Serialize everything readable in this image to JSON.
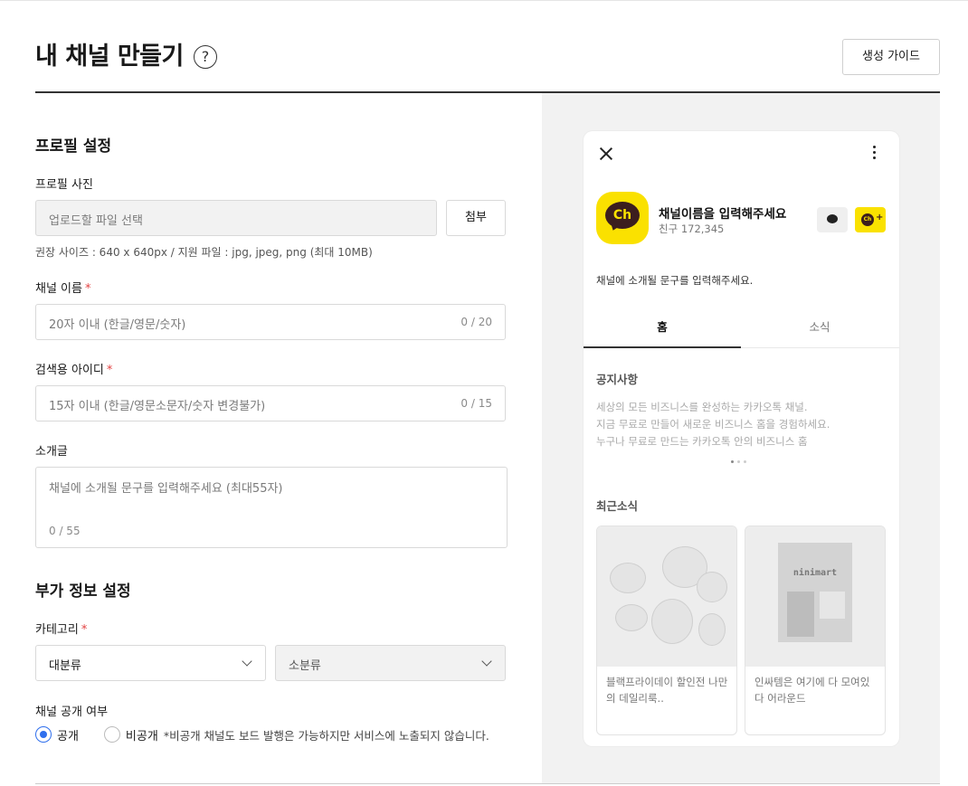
{
  "header": {
    "title": "내 채널 만들기",
    "help_symbol": "?",
    "guide_button": "생성 가이드"
  },
  "profile_section": {
    "title": "프로필 설정",
    "photo_label": "프로필 사진",
    "photo_placeholder": "업로드할 파일 선택",
    "attach_button": "첨부",
    "photo_hint": "권장 사이즈 : 640 x 640px / 지원 파일 : jpg, jpeg, png (최대 10MB)",
    "name_label": "채널 이름",
    "name_placeholder": "20자 이내 (한글/영문/숫자)",
    "name_counter": "0 / 20",
    "search_id_label": "검색용 아이디",
    "search_id_placeholder": "15자 이내 (한글/영문소문자/숫자 변경불가)",
    "search_id_counter": "0 / 15",
    "intro_label": "소개글",
    "intro_placeholder": "채널에 소개될 문구를 입력해주세요 (최대55자)",
    "intro_counter": "0 / 55",
    "required_mark": "*"
  },
  "extra_section": {
    "title": "부가 정보 설정",
    "category_label": "카테고리",
    "category_major": "대분류",
    "category_minor": "소분류",
    "visibility_label": "채널 공개 여부",
    "public_option": "공개",
    "private_option": "비공개",
    "private_note": "*비공개 채널도 보드 발행은 가능하지만 서비스에 노출되지 않습니다.",
    "selected": "공개"
  },
  "preview": {
    "logo_text": "Ch",
    "channel_name": "채널이름을 입력해주세요",
    "friends": "친구 172,345",
    "add_friend_plus": "+",
    "description": "채널에 소개될 문구를 입력해주세요.",
    "tabs": [
      "홈",
      "소식"
    ],
    "active_tab": "홈",
    "notice_title": "공지사항",
    "notice_lines": [
      "세상의 모든 비즈니스를 완성하는 카카오톡 채널.",
      "지금 무료로 만들어 새로운 비즈니스 홈을 경험하세요.",
      "누구나 무료로 만드는 카카오톡 안의 비즈니스 홈"
    ],
    "news_title": "최근소식",
    "cards": [
      {
        "text": "블랙프라이데이 할인전 나만의 데일리룩.."
      },
      {
        "text": "인싸템은 여기에 다 모여있다 어라운드",
        "sign": "ninimart"
      }
    ]
  }
}
